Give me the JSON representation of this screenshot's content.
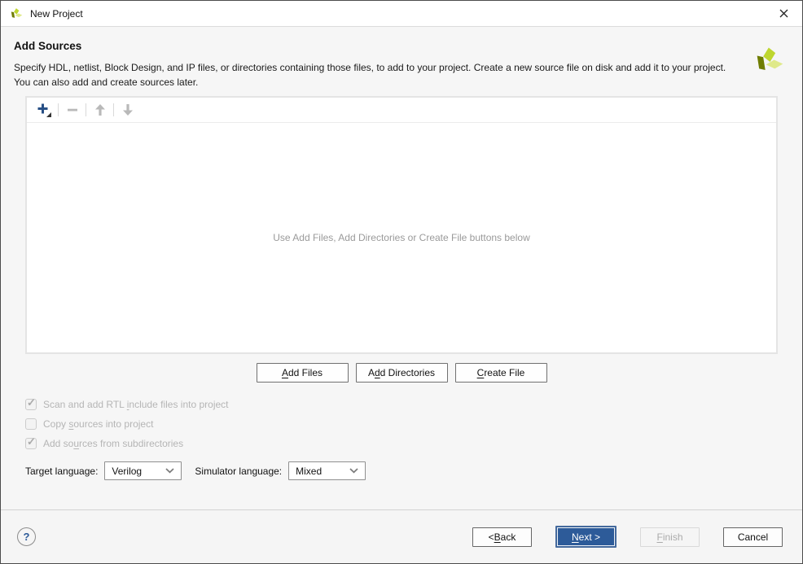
{
  "window": {
    "title": "New Project"
  },
  "icons": {
    "app": "vivado-pinwheel-logo",
    "close": "✕",
    "add": "+",
    "remove": "−",
    "move_up": "↑",
    "move_down": "↓",
    "combo_chevron": "▾",
    "help": "?"
  },
  "colors": {
    "accent_blue": "#2d5b99",
    "plus_blue": "#274f85",
    "logo_bright": "#bed62f",
    "logo_dark": "#6f7d00",
    "logo_pale": "#dfe98a",
    "disabled_text": "#b5b5b5"
  },
  "header": {
    "title": "Add Sources",
    "description_line1": "Specify HDL, netlist, Block Design, and IP files, or directories containing those files, to add to your project. Create a new source file on disk and add it to your project.",
    "description_line2": "You can also add and create sources later."
  },
  "sources_panel": {
    "empty_message": "Use Add Files, Add Directories or Create File buttons below"
  },
  "actions": {
    "add_files": {
      "pre": "",
      "key": "A",
      "post": "dd Files"
    },
    "add_directories": {
      "pre": "A",
      "key": "d",
      "post": "d Directories"
    },
    "create_file": {
      "pre": "",
      "key": "C",
      "post": "reate File"
    }
  },
  "options": {
    "items": [
      {
        "pre": "Scan and add RTL ",
        "key": "i",
        "post": "nclude files into project",
        "checked": true,
        "enabled": false
      },
      {
        "pre": "Copy ",
        "key": "s",
        "post": "ources into project",
        "checked": false,
        "enabled": false
      },
      {
        "pre": "Add so",
        "key": "u",
        "post": "rces from subdirectories",
        "checked": true,
        "enabled": false
      }
    ]
  },
  "language": {
    "target_label": "Target language:",
    "target_value": "Verilog",
    "simulator_label": "Simulator language:",
    "simulator_value": "Mixed"
  },
  "footer": {
    "help": "?",
    "back": {
      "pre": "< ",
      "key": "B",
      "post": "ack"
    },
    "next": {
      "pre": "",
      "key": "N",
      "post": "ext >"
    },
    "finish": {
      "pre": "",
      "key": "F",
      "post": "inish"
    },
    "cancel": {
      "pre": "Cancel",
      "key": "",
      "post": ""
    }
  }
}
